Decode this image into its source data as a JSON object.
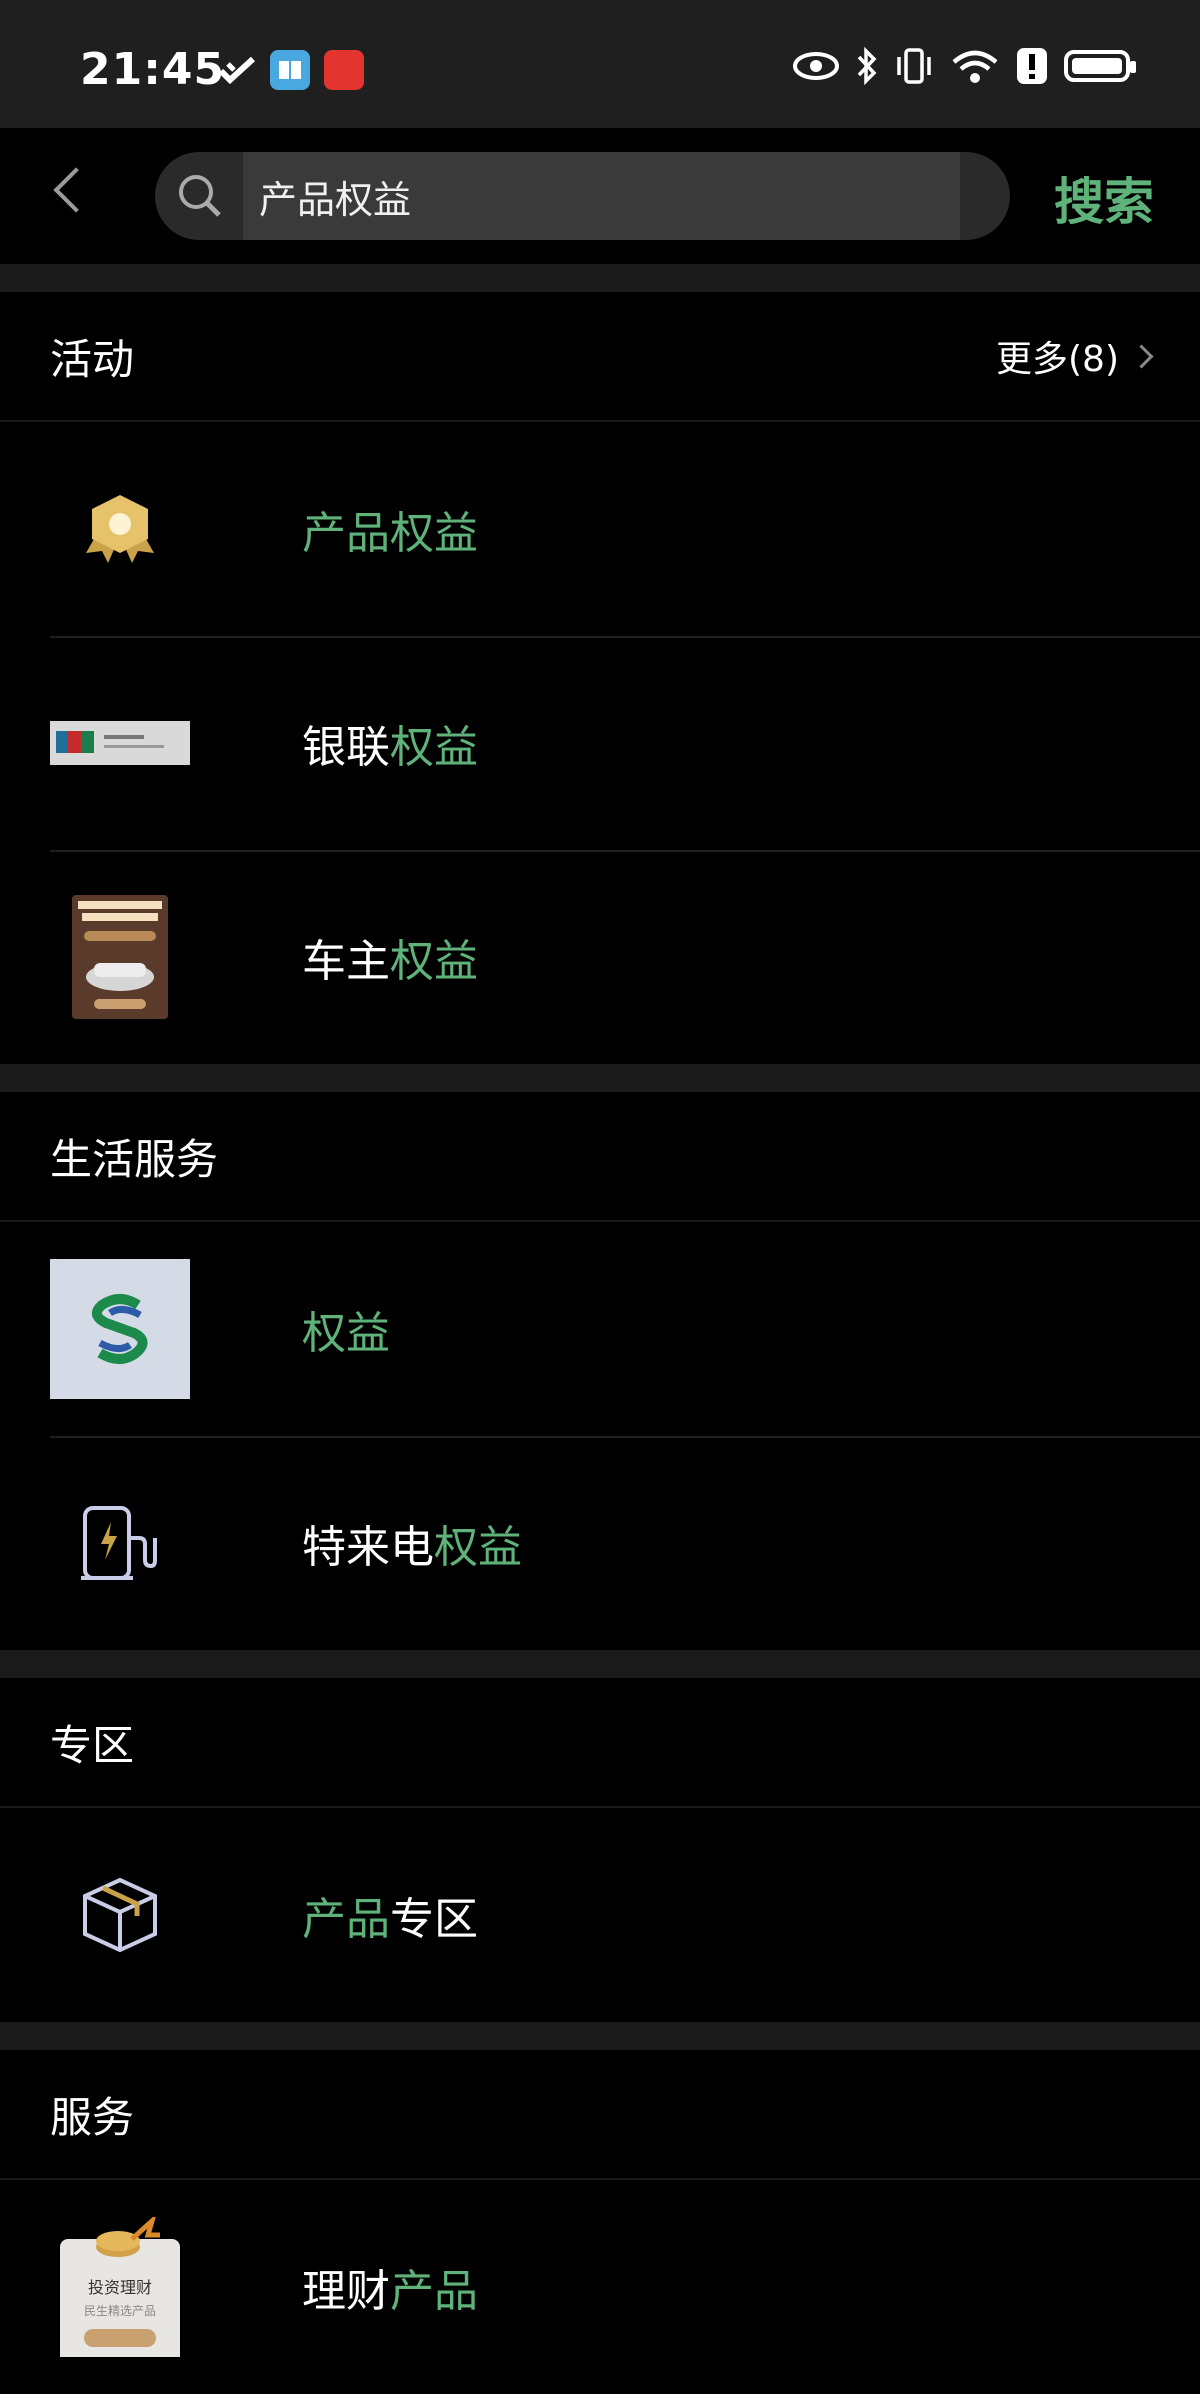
{
  "status": {
    "time": "21:45"
  },
  "search": {
    "query": "产品权益",
    "button": "搜索"
  },
  "sections": [
    {
      "title": "活动",
      "more": "更多(8)",
      "items": [
        {
          "parts": [
            {
              "t": "产品权益",
              "hl": true
            }
          ],
          "icon": "medal-icon"
        },
        {
          "parts": [
            {
              "t": "银联",
              "hl": false
            },
            {
              "t": "权益",
              "hl": true
            }
          ],
          "icon": "unionpay-card-thumbnail"
        },
        {
          "parts": [
            {
              "t": "车主",
              "hl": false
            },
            {
              "t": "权益",
              "hl": true
            }
          ],
          "icon": "car-wash-poster-thumbnail"
        }
      ]
    },
    {
      "title": "生活服务",
      "items": [
        {
          "parts": [
            {
              "t": "权益",
              "hl": true
            }
          ],
          "icon": "bank-logo-icon"
        },
        {
          "parts": [
            {
              "t": "特来电",
              "hl": false
            },
            {
              "t": "权益",
              "hl": true
            }
          ],
          "icon": "ev-charger-icon"
        }
      ]
    },
    {
      "title": "专区",
      "items": [
        {
          "parts": [
            {
              "t": "产品",
              "hl": true
            },
            {
              "t": "专区",
              "hl": false
            }
          ],
          "icon": "box-icon"
        }
      ]
    },
    {
      "title": "服务",
      "items": [
        {
          "parts": [
            {
              "t": "理财",
              "hl": false
            },
            {
              "t": "产品",
              "hl": true
            }
          ],
          "icon": "investment-card-icon"
        }
      ]
    }
  ],
  "thumb_text": {
    "investment_title": "投资理财",
    "investment_sub": "民生精选产品"
  },
  "colors": {
    "highlight": "#5fb37a",
    "background": "#000000",
    "separator": "#1a1a1a"
  }
}
